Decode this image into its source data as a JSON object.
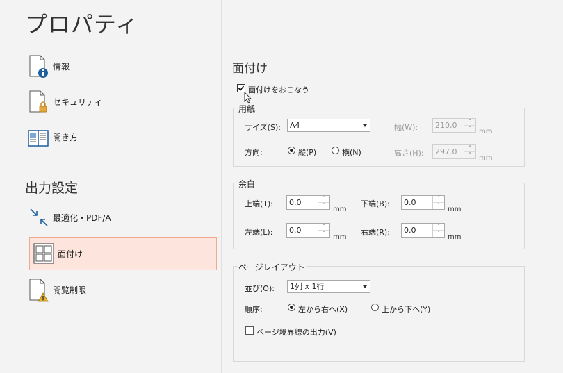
{
  "left": {
    "title": "プロパティ",
    "items": [
      {
        "label": "情報",
        "icon": "doc-info-icon"
      },
      {
        "label": "セキュリティ",
        "icon": "doc-lock-icon"
      },
      {
        "label": "開き方",
        "icon": "open-book-icon"
      }
    ],
    "output_heading": "出力設定",
    "output_items": [
      {
        "label": "最適化・PDF/A",
        "icon": "shrink-arrows-icon"
      },
      {
        "label": "面付け",
        "icon": "grid-layout-icon",
        "selected": true
      },
      {
        "label": "閲覧制限",
        "icon": "doc-warning-icon"
      }
    ]
  },
  "panel": {
    "heading": "面付け",
    "enable_label": "面付けをおこなう",
    "enable_checked": true,
    "paper": {
      "group": "用紙",
      "size_label": "サイズ(S):",
      "size_value": "A4",
      "width_label": "幅(W):",
      "width_value": "210.0",
      "height_label": "高さ(H):",
      "height_value": "297.0",
      "unit": "mm",
      "orientation_label": "方向:",
      "portrait_label": "縦(P)",
      "landscape_label": "横(N)",
      "orientation_selected": "portrait"
    },
    "margin": {
      "group": "余白",
      "top_label": "上端(T):",
      "top_value": "0.0",
      "bottom_label": "下端(B):",
      "bottom_value": "0.0",
      "left_label": "左端(L):",
      "left_value": "0.0",
      "right_label": "右端(R):",
      "right_value": "0.0",
      "unit": "mm"
    },
    "layout": {
      "group": "ページレイアウト",
      "arrange_label": "並び(O):",
      "arrange_value": "1列 x 1行",
      "order_label": "順序:",
      "lr_label": "左から右へ(X)",
      "tb_label": "上から下へ(Y)",
      "order_selected": "lr",
      "border_label": "ページ境界線の出力(V)",
      "border_checked": false
    }
  }
}
